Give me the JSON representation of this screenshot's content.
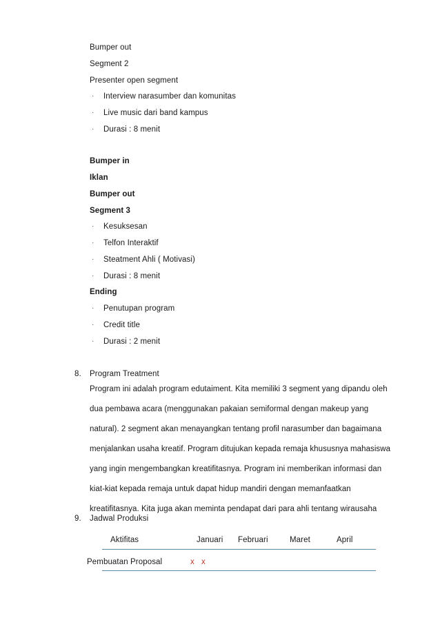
{
  "document": {
    "segment2_block": {
      "lines": [
        {
          "text": "Bumper out",
          "bold": false
        },
        {
          "text": "Segment 2",
          "bold": false
        },
        {
          "text": "Presenter open segment",
          "bold": false
        }
      ],
      "bullets": [
        "Interview narasumber dan komunitas",
        "Live music dari band kampus",
        "Durasi : 8 menit"
      ]
    },
    "segment3_block": {
      "lines": [
        {
          "text": "Bumper in",
          "bold": true
        },
        {
          "text": "Iklan",
          "bold": true
        },
        {
          "text": "Bumper out",
          "bold": true
        },
        {
          "text": "Segment 3",
          "bold": true
        }
      ],
      "bullets": [
        "Kesuksesan",
        "Telfon Interaktif",
        "Steatment Ahli ( Motivasi)",
        "Durasi : 8 menit"
      ]
    },
    "ending_block": {
      "heading": "Ending",
      "bullets": [
        "Penutupan program",
        "Credit title",
        "Durasi : 2 menit"
      ]
    },
    "section8": {
      "number": "8.",
      "title": "Program Treatment",
      "paragraph_lines": [
        "Program ini adalah program  edutaiment. Kita  memiliki 3 segment yang  dipandu oleh",
        "dua pembawa  acara (menggunakan pakaian semiformal dengan makeup yang",
        "natural). 2 segment akan menayangkan tentang profil narasumber dan bagaimana",
        "menjalankan usaha kreatif. Program ditujukan kepada remaja khususnya mahasiswa",
        "yang ingin mengembangkan kreatifitasnya. Program ini memberikan  informasi dan",
        "kiat-kiat kepada remaja  untuk  dapat hidup mandiri  dengan memanfaatkan",
        "kreatifitasnya. Kita juga akan meminta  pendapat dari para ahli tentang wirausaha"
      ]
    },
    "section9": {
      "number": "9.",
      "title": "Jadwal Produksi",
      "table": {
        "headers": [
          "Aktifitas",
          "Januari",
          "Februari",
          "Maret",
          "April"
        ],
        "rows": [
          {
            "activity": "Pembuatan Proposal",
            "marks": [
              "x",
              "x"
            ]
          }
        ],
        "mark_color": "#C0392B",
        "rule_color": "#5B87A8"
      }
    }
  }
}
